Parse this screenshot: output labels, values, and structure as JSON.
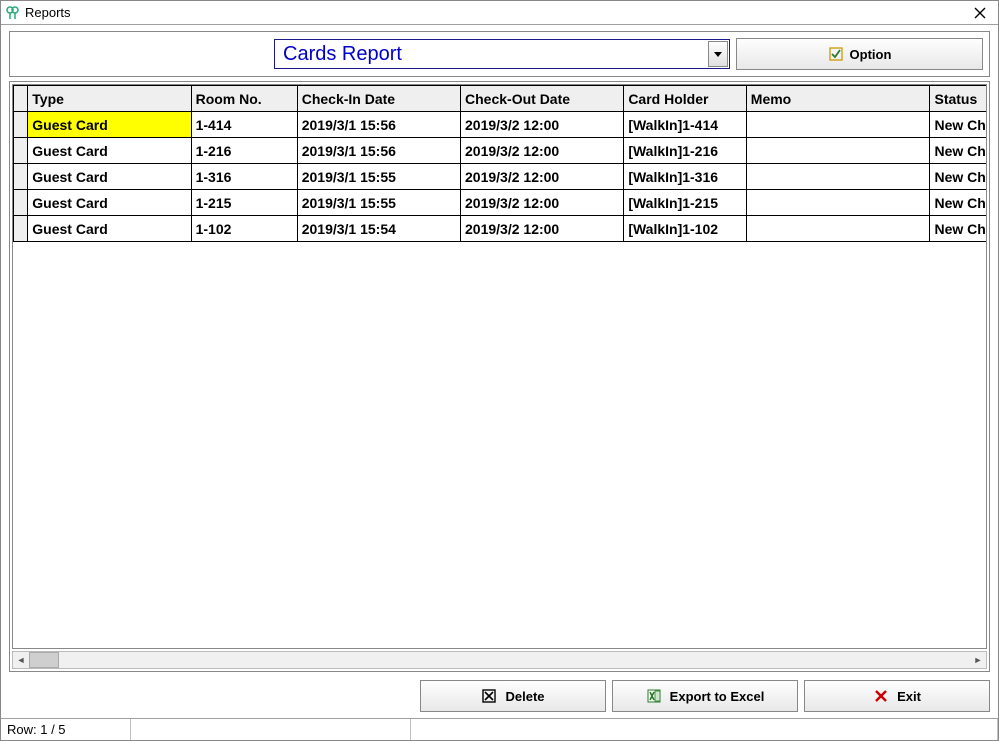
{
  "window": {
    "title": "Reports"
  },
  "toolbar": {
    "report_combo_text": "Cards Report",
    "option_label": "Option"
  },
  "grid": {
    "columns": {
      "type": "Type",
      "room": "Room No.",
      "checkin": "Check-In Date",
      "checkout": "Check-Out Date",
      "holder": "Card Holder",
      "memo": "Memo",
      "status": "Status"
    },
    "rows": [
      {
        "type": "Guest Card",
        "room": "1-414",
        "checkin": "2019/3/1 15:56",
        "checkout": "2019/3/2 12:00",
        "holder": "[WalkIn]1-414",
        "memo": "",
        "status": "New Check-i"
      },
      {
        "type": "Guest Card",
        "room": "1-216",
        "checkin": "2019/3/1 15:56",
        "checkout": "2019/3/2 12:00",
        "holder": "[WalkIn]1-216",
        "memo": "",
        "status": "New Check-i"
      },
      {
        "type": "Guest Card",
        "room": "1-316",
        "checkin": "2019/3/1 15:55",
        "checkout": "2019/3/2 12:00",
        "holder": "[WalkIn]1-316",
        "memo": "",
        "status": "New Check-i"
      },
      {
        "type": "Guest Card",
        "room": "1-215",
        "checkin": "2019/3/1 15:55",
        "checkout": "2019/3/2 12:00",
        "holder": "[WalkIn]1-215",
        "memo": "",
        "status": "New Check-i"
      },
      {
        "type": "Guest Card",
        "room": "1-102",
        "checkin": "2019/3/1 15:54",
        "checkout": "2019/3/2 12:00",
        "holder": "[WalkIn]1-102",
        "memo": "",
        "status": "New Check-i"
      }
    ],
    "selected_row": 0
  },
  "actions": {
    "delete_label": "Delete",
    "export_label": "Export to Excel",
    "exit_label": "Exit"
  },
  "statusbar": {
    "row_info": "Row: 1 / 5"
  }
}
